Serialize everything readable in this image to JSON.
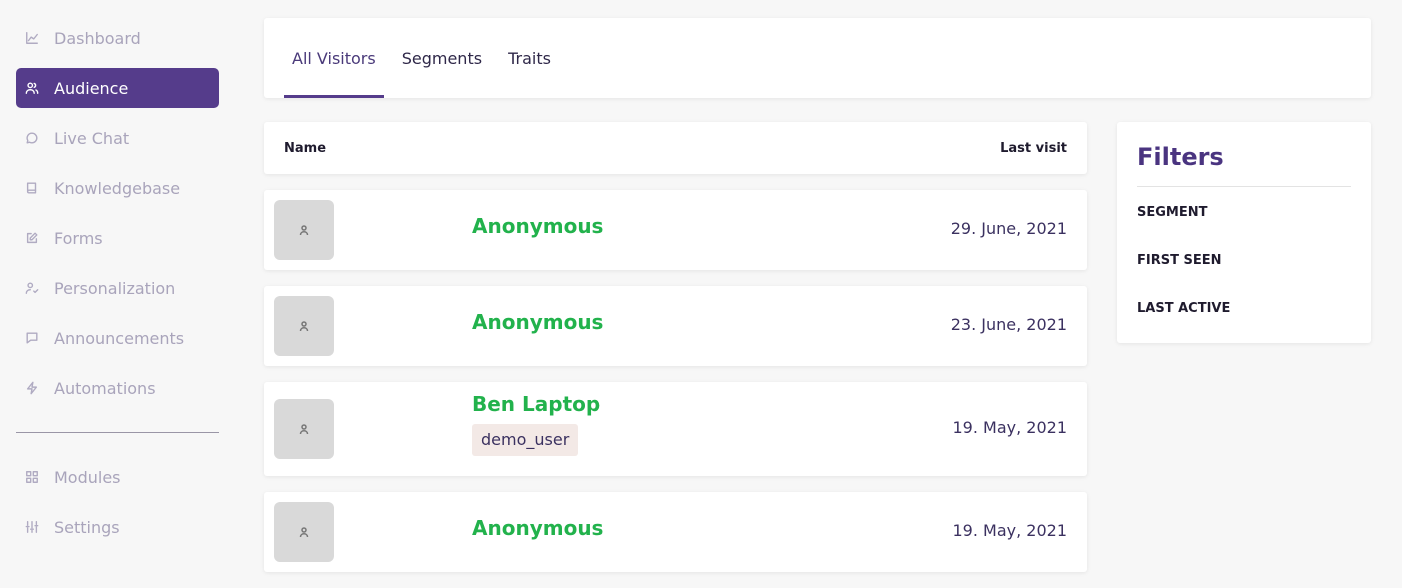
{
  "sidebar": {
    "items": [
      {
        "label": "Dashboard",
        "icon": "chart-icon"
      },
      {
        "label": "Audience",
        "icon": "users-icon",
        "active": true
      },
      {
        "label": "Live Chat",
        "icon": "chat-bubble-icon"
      },
      {
        "label": "Knowledgebase",
        "icon": "book-icon"
      },
      {
        "label": "Forms",
        "icon": "edit-icon"
      },
      {
        "label": "Personalization",
        "icon": "user-check-icon"
      },
      {
        "label": "Announcements",
        "icon": "message-square-icon"
      },
      {
        "label": "Automations",
        "icon": "lightning-icon"
      }
    ],
    "bottom_items": [
      {
        "label": "Modules",
        "icon": "grid-icon"
      },
      {
        "label": "Settings",
        "icon": "sliders-icon"
      }
    ]
  },
  "tabs": [
    {
      "label": "All Visitors",
      "active": true
    },
    {
      "label": "Segments"
    },
    {
      "label": "Traits"
    }
  ],
  "table": {
    "columns": {
      "name": "Name",
      "last_visit": "Last visit"
    },
    "rows": [
      {
        "name": "Anonymous",
        "tag": "",
        "last_visit": "29. June, 2021"
      },
      {
        "name": "Anonymous",
        "tag": "",
        "last_visit": "23. June, 2021"
      },
      {
        "name": "Ben Laptop",
        "tag": "demo_user",
        "last_visit": "19. May, 2021"
      },
      {
        "name": "Anonymous",
        "tag": "",
        "last_visit": "19. May, 2021"
      }
    ]
  },
  "filters": {
    "title": "Filters",
    "items": [
      "SEGMENT",
      "FIRST SEEN",
      "LAST ACTIVE"
    ]
  },
  "colors": {
    "accent": "#553c8b",
    "name_green": "#22b24c",
    "tag_bg": "#f3e9e6"
  }
}
